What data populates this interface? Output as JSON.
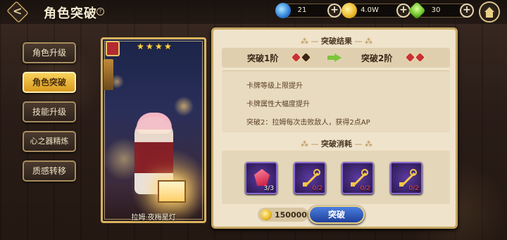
{
  "header": {
    "title": "角色突破",
    "help": "?",
    "resources": [
      {
        "name": "crystal",
        "value": "21",
        "plus": "+"
      },
      {
        "name": "coin",
        "value": "4.0W",
        "plus": "+"
      },
      {
        "name": "gem",
        "value": "30",
        "plus": "+"
      }
    ]
  },
  "menu": [
    {
      "label": "角色升级",
      "active": false
    },
    {
      "label": "角色突破",
      "active": true
    },
    {
      "label": "技能升级",
      "active": false
    },
    {
      "label": "心之器精炼",
      "active": false
    },
    {
      "label": "质感转移",
      "active": false
    }
  ],
  "card": {
    "name": "拉姆·夜梅星灯",
    "stars": [
      "★",
      "★",
      "★",
      "★"
    ]
  },
  "result": {
    "title": "突破结果",
    "from_stage": "突破1阶",
    "to_stage": "突破2阶",
    "effects": [
      "卡牌等级上限提升",
      "卡牌属性大幅度提升",
      "突破2：拉姆每次击败敌人，获得2点AP"
    ]
  },
  "consume": {
    "title": "突破消耗",
    "items": [
      {
        "name": "crystal-shard",
        "count": "3/3"
      },
      {
        "name": "gold-key-a",
        "count": "0/2"
      },
      {
        "name": "gold-key-b",
        "count": "0/2"
      },
      {
        "name": "gold-key-c",
        "count": "0/2"
      }
    ],
    "cost": "150000",
    "button": "突破"
  },
  "colors": {
    "panel": "#efe3cb",
    "accent_gold": "#c6a762",
    "active_menu": "#f8d15a",
    "button_blue": "#1e3f9a",
    "insufficient": "#ff4a4a"
  }
}
